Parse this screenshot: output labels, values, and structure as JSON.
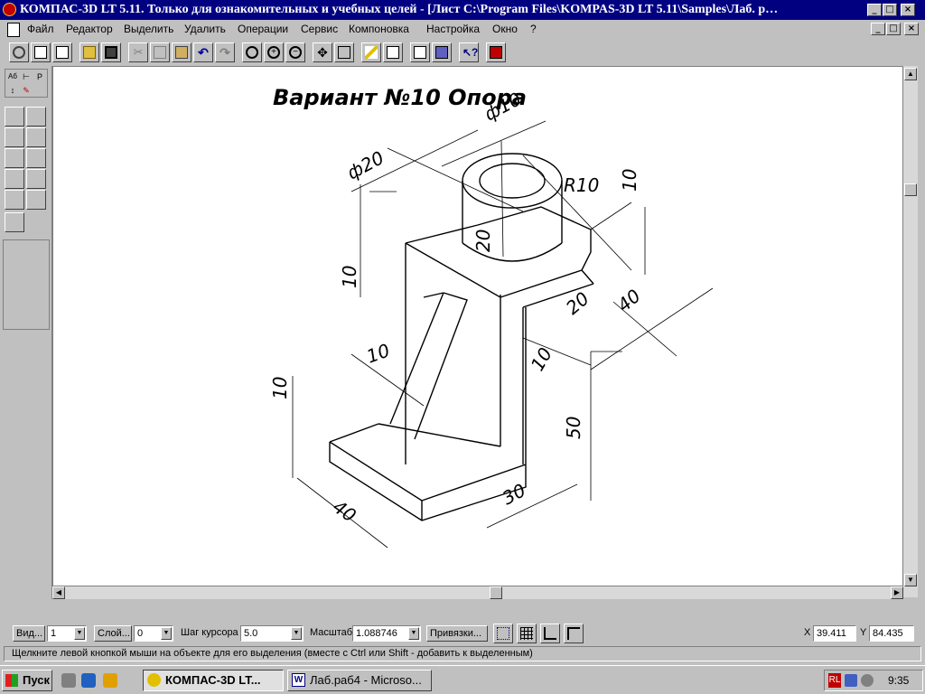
{
  "window": {
    "title": "КОМПАС-3D LT 5.11. Только для ознакомительных и учебных целей - [Лист C:\\Program Files\\KOMPAS-3D LT 5.11\\Samples\\Лаб. р…",
    "logo_icon": "kompas-logo-icon"
  },
  "menu": [
    "Файл",
    "Редактор",
    "Выделить",
    "Удалить",
    "Операции",
    "Сервис",
    "Компоновка",
    "Настройка",
    "Окно",
    "?"
  ],
  "drawing": {
    "title": "Вариант №10 Опора",
    "dimensions": [
      "ф10",
      "ф20",
      "R10",
      "10",
      "20",
      "10",
      "20",
      "40",
      "10",
      "10",
      "10",
      "50",
      "40",
      "30"
    ]
  },
  "status": {
    "view_button": "Вид...",
    "view_value": "1",
    "layer_button": "Слой...",
    "layer_value": "0",
    "step_label": "Шаг курсора",
    "step_value": "5.0",
    "scale_label": "Масштаб",
    "scale_value": "1.088746",
    "snap_button": "Привязки...",
    "x_label": "X",
    "x_value": "39.411",
    "y_label": "Y",
    "y_value": "84.435"
  },
  "hint": "Щелкните левой кнопкой мыши на объекте для его выделения (вместе с Ctrl или Shift - добавить к выделенным)",
  "taskbar": {
    "start": "Пуск",
    "tasks": [
      "КОМПАС-3D LT...",
      "Лаб.раб4 - Microso..."
    ],
    "lang": "RL",
    "clock": "9:35"
  },
  "colors": {
    "titlebar": "#000080",
    "face": "#c0c0c0",
    "canvas": "#ffffff"
  }
}
